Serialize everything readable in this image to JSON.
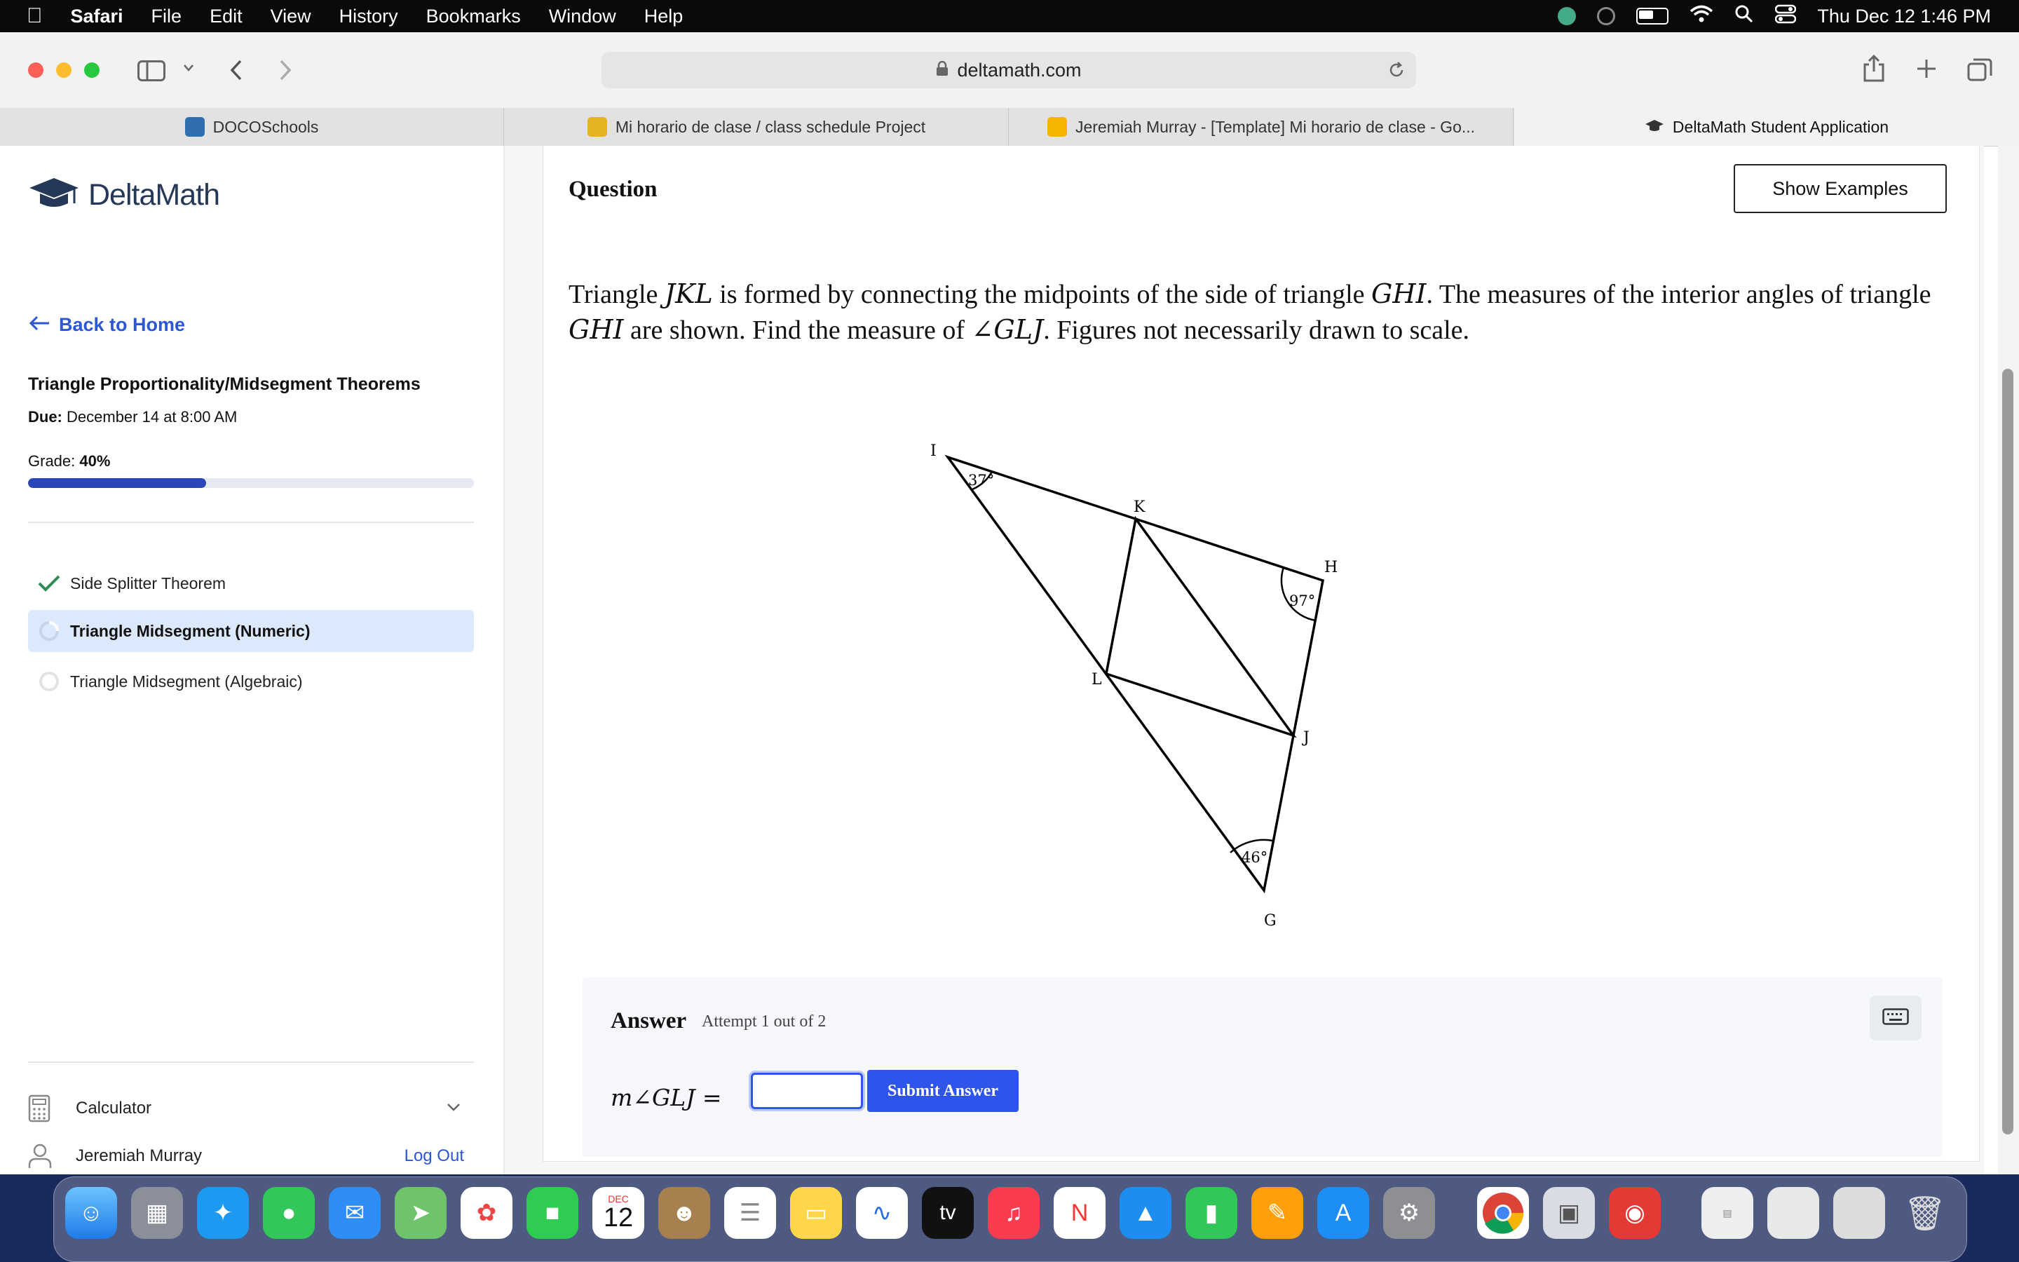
{
  "menubar": {
    "items": [
      "Safari",
      "File",
      "Edit",
      "View",
      "History",
      "Bookmarks",
      "Window",
      "Help"
    ],
    "clock": "Thu Dec 12  1:46 PM"
  },
  "browser": {
    "url": "deltamath.com",
    "tabs": [
      {
        "label": "DOCOSchools",
        "color": "#2f6fb0"
      },
      {
        "label": "Mi horario de clase / class schedule Project",
        "color": "#e6b422"
      },
      {
        "label": "Jeremiah Murray - [Template] Mi horario de clase - Go...",
        "color": "#f4b400"
      },
      {
        "label": "DeltaMath Student Application",
        "color": "#333333"
      }
    ]
  },
  "sidebar": {
    "logo": "DeltaMath",
    "back_link": "Back to Home",
    "assignment_title": "Triangle Proportionality/Midsegment Theorems",
    "due_label": "Due:",
    "due_value": "December 14 at 8:00 AM",
    "grade_label": "Grade:",
    "grade_value": "40%",
    "grade_fraction": 0.4,
    "skills": [
      {
        "label": "Side Splitter Theorem",
        "status": "complete"
      },
      {
        "label": "Triangle Midsegment (Numeric)",
        "status": "active"
      },
      {
        "label": "Triangle Midsegment (Algebraic)",
        "status": "pending"
      }
    ],
    "calculator_label": "Calculator",
    "user_name": "Jeremiah Murray",
    "logout_label": "Log Out"
  },
  "question": {
    "heading": "Question",
    "show_examples": "Show Examples",
    "text_parts": [
      "Triangle ",
      "JKL",
      " is formed by connecting the midpoints of the side of triangle ",
      "GHI",
      ". The measures of the interior angles of triangle ",
      "GHI",
      " are shown. Find the measure of ",
      "∠GLJ",
      ". Figures not necessarily drawn to scale."
    ],
    "figure": {
      "vertices": [
        "I",
        "K",
        "H",
        "L",
        "J",
        "G"
      ],
      "angles": {
        "I": "37°",
        "H": "97°",
        "G": "46°"
      }
    }
  },
  "answer": {
    "heading": "Answer",
    "attempt": "Attempt 1 out of 2",
    "prompt": "m∠GLJ =",
    "input_value": "",
    "submit_label": "Submit Answer"
  },
  "colors": {
    "accent": "#2f54eb",
    "link": "#2b56d4",
    "progress": "#2b46b8",
    "check": "#2e8b57",
    "active_skill_bg": "#dce8fb"
  },
  "dock": {
    "calendar_month": "DEC",
    "calendar_day": "12",
    "tv_label": "tv"
  }
}
